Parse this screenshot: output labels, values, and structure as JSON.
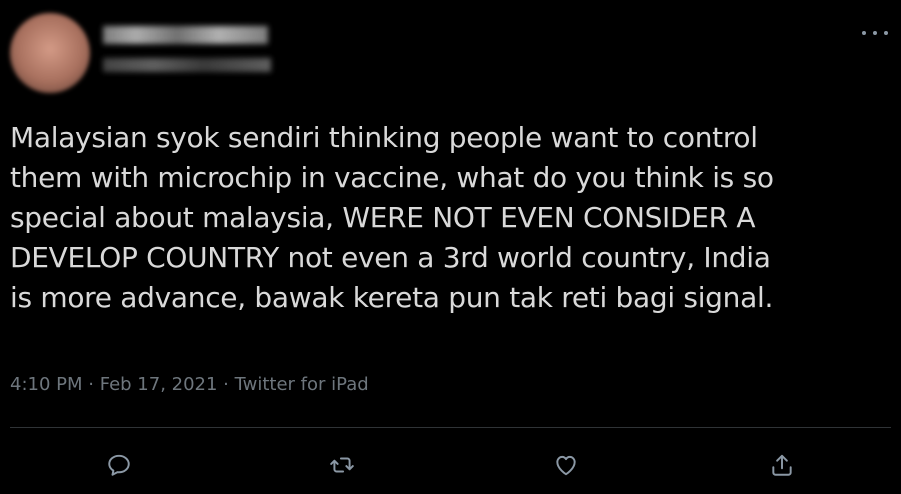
{
  "tweet": {
    "text_lines": [
      "Malaysian syok sendiri thinking people want to control",
      "them with microchip in vaccine, what do you think is so",
      "special about malaysia, WERE NOT EVEN CONSIDER A",
      "DEVELOP COUNTRY not even a 3rd world country, India",
      "is more advance, bawak kereta pun tak reti bagi signal."
    ],
    "time": "4:10 PM",
    "separator": " · ",
    "date": "Feb 17, 2021",
    "source": "Twitter for iPad"
  },
  "icons": {
    "more": "more-options-icon",
    "reply": "reply-icon",
    "retweet": "retweet-icon",
    "like": "like-icon",
    "share": "share-icon"
  },
  "colors": {
    "background": "#000000",
    "text": "#d9d9d9",
    "meta": "#6e767d",
    "icon": "#8b98a5",
    "divider": "#2f3336"
  }
}
